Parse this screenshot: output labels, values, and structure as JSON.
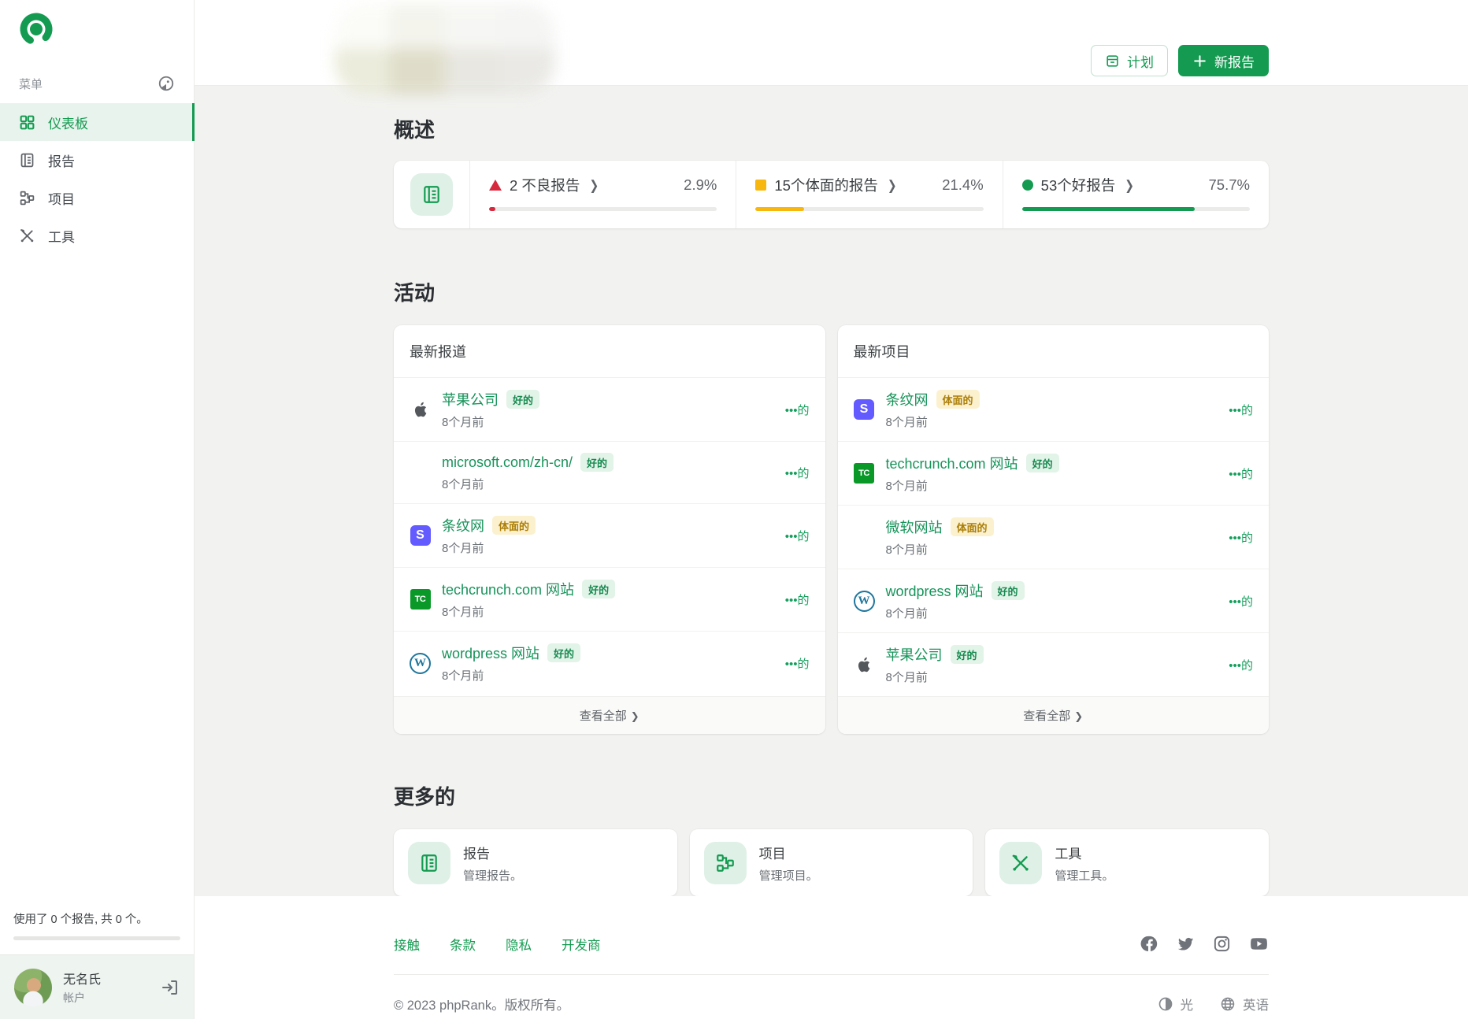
{
  "brand": {
    "accent_color": "#149b51",
    "light_green": "#dff0e7",
    "red": "#d6293e",
    "yellow": "#f7b70f"
  },
  "sidebar": {
    "menu_label": "菜单",
    "items": [
      {
        "label": "仪表板",
        "icon": "dashboard",
        "active": true
      },
      {
        "label": "报告",
        "icon": "reports",
        "active": false
      },
      {
        "label": "项目",
        "icon": "projects",
        "active": false
      },
      {
        "label": "工具",
        "icon": "tools",
        "active": false
      }
    ],
    "usage_text": "使用了 0 个报告, 共 0 个。",
    "user": {
      "name": "无名氏",
      "role": "帐户"
    }
  },
  "header": {
    "plan_button": "计划",
    "new_report_button": "新报告"
  },
  "overview": {
    "title": "概述",
    "stats": [
      {
        "label": "2 不良报告",
        "value": "2.9%",
        "percent": 2.9,
        "color": "#d6293e",
        "shape": "triangle"
      },
      {
        "label": "15个体面的报告",
        "value": "21.4%",
        "percent": 21.4,
        "color": "#f7b70f",
        "shape": "square"
      },
      {
        "label": "53个好报告",
        "value": "75.7%",
        "percent": 75.7,
        "color": "#149b51",
        "shape": "circle"
      }
    ]
  },
  "activity": {
    "title": "活动",
    "lists": [
      {
        "title": "最新报道",
        "view_all": "查看全部",
        "rows": [
          {
            "site": "apple",
            "title": "苹果公司",
            "badge": "好的",
            "badge_type": "good",
            "time": "8个月前",
            "more": "•••的"
          },
          {
            "site": "microsoft",
            "title": "microsoft.com/zh-cn/",
            "badge": "好的",
            "badge_type": "good",
            "time": "8个月前",
            "more": "•••的"
          },
          {
            "site": "stripe",
            "title": "条纹网",
            "badge": "体面的",
            "badge_type": "decent",
            "time": "8个月前",
            "more": "•••的"
          },
          {
            "site": "techcrunch",
            "title": "techcrunch.com 网站",
            "badge": "好的",
            "badge_type": "good",
            "time": "8个月前",
            "more": "•••的"
          },
          {
            "site": "wordpress",
            "title": "wordpress 网站",
            "badge": "好的",
            "badge_type": "good",
            "time": "8个月前",
            "more": "•••的"
          }
        ]
      },
      {
        "title": "最新项目",
        "view_all": "查看全部",
        "rows": [
          {
            "site": "stripe",
            "title": "条纹网",
            "badge": "体面的",
            "badge_type": "decent",
            "time": "8个月前",
            "more": "•••的"
          },
          {
            "site": "techcrunch",
            "title": "techcrunch.com 网站",
            "badge": "好的",
            "badge_type": "good",
            "time": "8个月前",
            "more": "•••的"
          },
          {
            "site": "microsoft",
            "title": "微软网站",
            "badge": "体面的",
            "badge_type": "decent",
            "time": "8个月前",
            "more": "•••的"
          },
          {
            "site": "wordpress",
            "title": "wordpress 网站",
            "badge": "好的",
            "badge_type": "good",
            "time": "8个月前",
            "more": "•••的"
          },
          {
            "site": "apple",
            "title": "苹果公司",
            "badge": "好的",
            "badge_type": "good",
            "time": "8个月前",
            "more": "•••的"
          }
        ]
      }
    ]
  },
  "more": {
    "title": "更多的",
    "cards": [
      {
        "title": "报告",
        "desc": "管理报告。",
        "icon": "reports"
      },
      {
        "title": "项目",
        "desc": "管理项目。",
        "icon": "projects"
      },
      {
        "title": "工具",
        "desc": "管理工具。",
        "icon": "tools"
      }
    ]
  },
  "footer": {
    "links": [
      "接触",
      "条款",
      "隐私",
      "开发商"
    ],
    "social_icons": [
      "facebook",
      "twitter",
      "instagram",
      "youtube"
    ],
    "copyright": "© 2023 phpRank。版权所有。",
    "theme_label": "光",
    "language_label": "英语"
  }
}
